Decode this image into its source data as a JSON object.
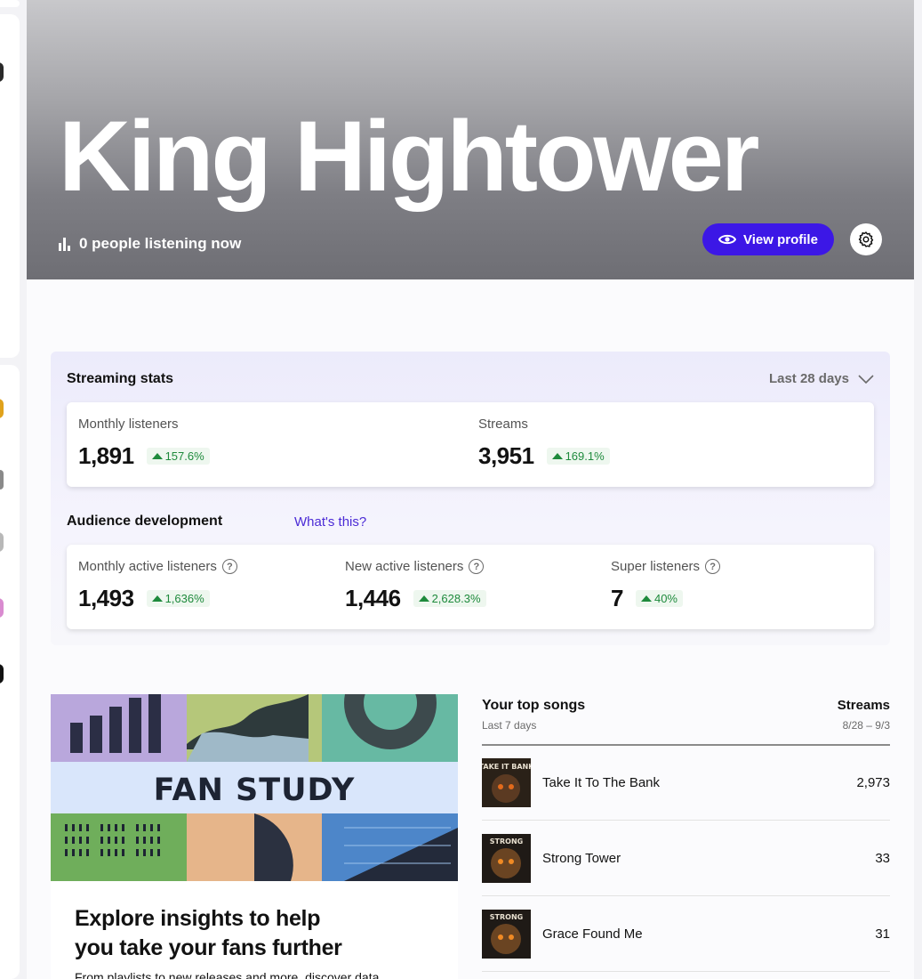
{
  "artist": {
    "name": "King Hightower",
    "listening_now": "0 people listening now",
    "view_profile_label": "View profile"
  },
  "streaming_stats": {
    "title": "Streaming stats",
    "range": "Last 28 days",
    "items": [
      {
        "label": "Monthly listeners",
        "value": "1,891",
        "change": "157.6%"
      },
      {
        "label": "Streams",
        "value": "3,951",
        "change": "169.1%"
      }
    ]
  },
  "audience": {
    "title": "Audience development",
    "link": "What's this?",
    "items": [
      {
        "label": "Monthly active listeners",
        "value": "1,493",
        "change": "1,636%"
      },
      {
        "label": "New active listeners",
        "value": "1,446",
        "change": "2,628.3%"
      },
      {
        "label": "Super listeners",
        "value": "7",
        "change": "40%"
      }
    ]
  },
  "fan_study": {
    "banner": "FAN STUDY",
    "heading_line1": "Explore insights to help",
    "heading_line2": "you take your fans further",
    "body": "From playlists to new releases and more, discover data"
  },
  "top_songs": {
    "title": "Your top songs",
    "subtitle": "Last 7 days",
    "streams_header": "Streams",
    "range": "8/28 – 9/3",
    "songs": [
      {
        "name": "Take It To The Bank",
        "streams": "2,973",
        "cover_text": "TAKE IT BANK"
      },
      {
        "name": "Strong Tower",
        "streams": "33",
        "cover_text": "STRONG"
      },
      {
        "name": "Grace Found Me",
        "streams": "31",
        "cover_text": "STRONG"
      }
    ]
  },
  "colors": {
    "accent": "#3c17e6",
    "positive": "#1e8a3c",
    "link": "#4b2bd6"
  }
}
